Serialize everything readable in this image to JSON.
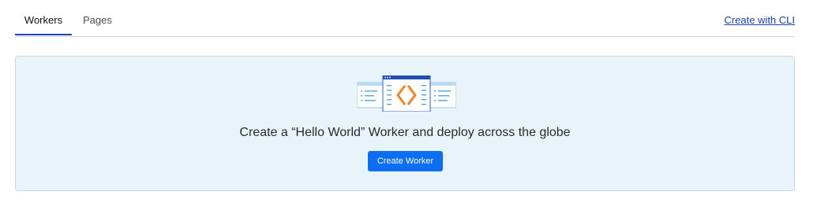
{
  "tabs": [
    {
      "label": "Workers",
      "active": true
    },
    {
      "label": "Pages",
      "active": false
    }
  ],
  "header": {
    "cli_link": "Create with CLI"
  },
  "empty_state": {
    "illustration_icon": "code-windows-illustration",
    "headline": "Create a “Hello World” Worker and deploy across the globe",
    "button_label": "Create Worker"
  },
  "colors": {
    "accent": "#0b6ef3",
    "tab_underline": "#1b46b8",
    "card_bg": "#e8f4fa",
    "illustration_orange": "#f3841e"
  }
}
